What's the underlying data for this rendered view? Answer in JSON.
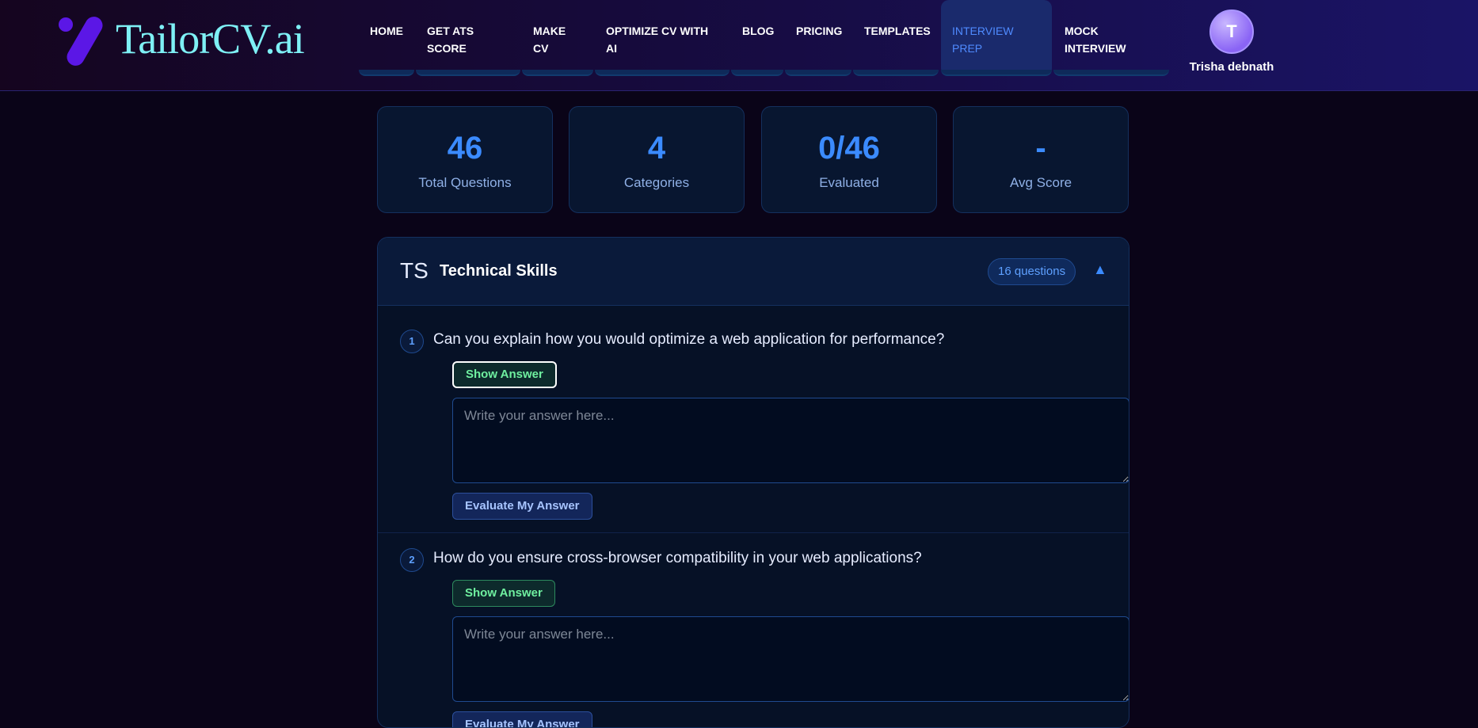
{
  "brand": {
    "logo_text": "TailorCV.ai"
  },
  "nav": {
    "items": [
      {
        "label": "HOME"
      },
      {
        "label": "GET ATS SCORE"
      },
      {
        "label": "MAKE CV"
      },
      {
        "label": "OPTIMIZE CV WITH AI"
      },
      {
        "label": "BLOG"
      },
      {
        "label": "PRICING"
      },
      {
        "label": "TEMPLATES"
      },
      {
        "label": "INTERVIEW PREP",
        "active": true
      },
      {
        "label": "MOCK INTERVIEW"
      }
    ],
    "user": {
      "initial": "T",
      "name": "Trisha debnath"
    }
  },
  "stats": [
    {
      "value": "46",
      "label": "Total Questions"
    },
    {
      "value": "4",
      "label": "Categories"
    },
    {
      "value": "0/46",
      "label": "Evaluated"
    },
    {
      "value": "-",
      "label": "Avg Score"
    }
  ],
  "category": {
    "abbr": "TS",
    "title": "Technical Skills",
    "count_label": "16 questions",
    "collapse_icon": "▲",
    "questions": [
      {
        "number": "1",
        "text": "Can you explain how you would optimize a web application for performance?",
        "show_answer_label": "Show Answer",
        "answer_placeholder": "Write your answer here...",
        "evaluate_label": "Evaluate My Answer"
      },
      {
        "number": "2",
        "text": "How do you ensure cross-browser compatibility in your web applications?",
        "show_answer_label": "Show Answer",
        "answer_placeholder": "Write your answer here...",
        "evaluate_label": "Evaluate My Answer"
      }
    ]
  },
  "colors": {
    "accent": "#3b8bff",
    "nav_gradient_end": "#1a1466",
    "background": "#0a0418",
    "show_answer_green": "#6ff0a0",
    "logo_cyan": "#7ef0f5",
    "logo_purple": "#5b17e6"
  }
}
